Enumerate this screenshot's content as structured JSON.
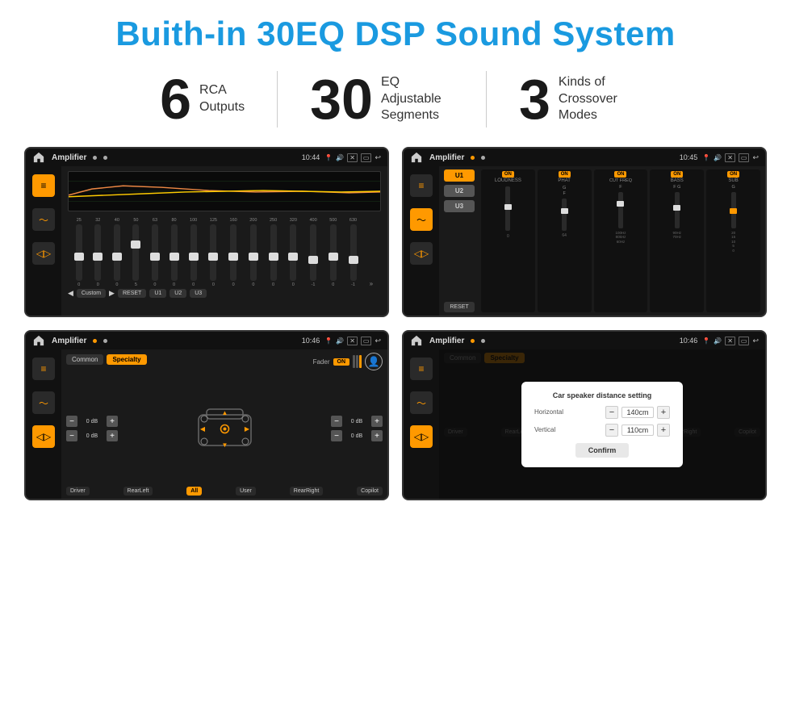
{
  "page": {
    "title": "Buith-in 30EQ DSP Sound System",
    "stats": [
      {
        "number": "6",
        "label": "RCA\nOutputs"
      },
      {
        "number": "30",
        "label": "EQ Adjustable\nSegments"
      },
      {
        "number": "3",
        "label": "Kinds of\nCrossover Modes"
      }
    ],
    "screens": [
      {
        "id": "eq-screen",
        "status_title": "Amplifier",
        "status_time": "10:44",
        "type": "eq"
      },
      {
        "id": "crossover-screen",
        "status_title": "Amplifier",
        "status_time": "10:45",
        "type": "crossover"
      },
      {
        "id": "fader-screen",
        "status_title": "Amplifier",
        "status_time": "10:46",
        "type": "fader"
      },
      {
        "id": "dialog-screen",
        "status_title": "Amplifier",
        "status_time": "10:46",
        "type": "dialog"
      }
    ],
    "eq": {
      "freqs": [
        "25",
        "32",
        "40",
        "50",
        "63",
        "80",
        "100",
        "125",
        "160",
        "200",
        "250",
        "320",
        "400",
        "500",
        "630"
      ],
      "values": [
        "0",
        "0",
        "0",
        "5",
        "0",
        "0",
        "0",
        "0",
        "0",
        "0",
        "0",
        "0",
        "-1",
        "0",
        "-1"
      ],
      "preset": "Custom",
      "buttons": [
        "RESET",
        "U1",
        "U2",
        "U3"
      ]
    },
    "crossover": {
      "u_buttons": [
        "U1",
        "U2",
        "U3"
      ],
      "channels": [
        "LOUDNESS",
        "PHAT",
        "CUT FREQ",
        "BASS",
        "SUB"
      ],
      "reset": "RESET"
    },
    "fader": {
      "tabs": [
        "Common",
        "Specialty"
      ],
      "fader_label": "Fader",
      "on_label": "ON",
      "db_values": [
        "0 dB",
        "0 dB",
        "0 dB",
        "0 dB"
      ],
      "bottom_buttons": [
        "Driver",
        "RearLeft",
        "All",
        "User",
        "RearRight",
        "Copilot"
      ]
    },
    "dialog": {
      "title": "Car speaker distance setting",
      "horizontal_label": "Horizontal",
      "horizontal_value": "140cm",
      "vertical_label": "Vertical",
      "vertical_value": "110cm",
      "confirm_label": "Confirm",
      "tabs": [
        "Common",
        "Specialty"
      ]
    }
  }
}
